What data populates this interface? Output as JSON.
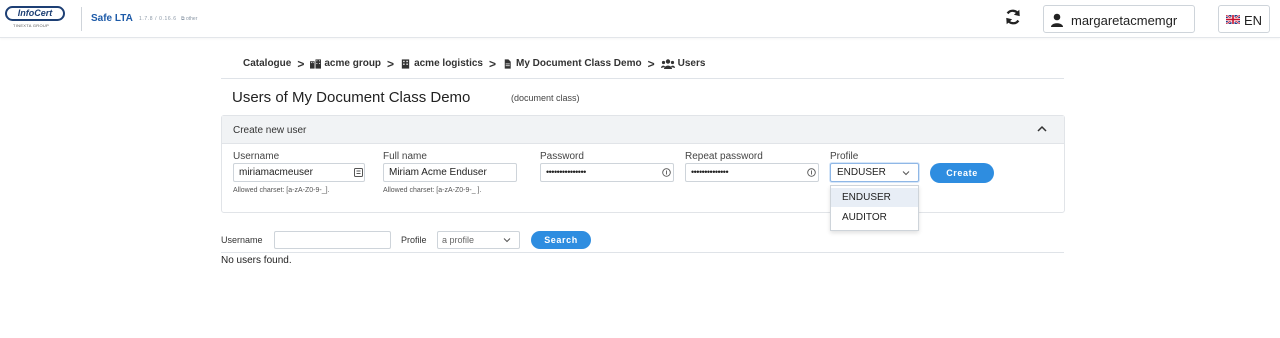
{
  "header": {
    "logo_text": "InfoCert",
    "logo_subtext": "TINEXTA GROUP",
    "app_name": "Safe LTA",
    "app_version": "1.7.8 / 0.16.6",
    "app_other": "other",
    "user_name": "margaretacmemgr",
    "language": "EN"
  },
  "breadcrumb": [
    {
      "label": "Catalogue",
      "icon": "none"
    },
    {
      "label": "acme group",
      "icon": "buildings-icon"
    },
    {
      "label": "acme logistics",
      "icon": "building-icon"
    },
    {
      "label": "My Document Class Demo",
      "icon": "document-icon"
    },
    {
      "label": "Users",
      "icon": "users-icon"
    }
  ],
  "page": {
    "title": "Users of My Document Class Demo",
    "subtitle": "(document class)"
  },
  "create_panel": {
    "title": "Create new user",
    "username": {
      "label": "Username",
      "value": "miriamacmeuser",
      "hint": "Allowed charset: [a-zA-Z0-9-_]."
    },
    "full_name": {
      "label": "Full name",
      "value": "Miriam Acme Enduser",
      "hint": "Allowed charset: [a-zA-Z0-9-_ ]."
    },
    "password": {
      "label": "Password",
      "value": "•••••••••••••••"
    },
    "repeat_password": {
      "label": "Repeat password",
      "value": "••••••••••••••"
    },
    "profile": {
      "label": "Profile",
      "value": "ENDUSER",
      "options": [
        "ENDUSER",
        "AUDITOR"
      ]
    },
    "create_label": "Create"
  },
  "search": {
    "username_label": "Username",
    "username_value": "",
    "profile_label": "Profile",
    "profile_placeholder": "a profile",
    "search_label": "Search",
    "empty_message": "No users found."
  },
  "colors": {
    "accent": "#2e8de0",
    "brand": "#1d3f74"
  }
}
